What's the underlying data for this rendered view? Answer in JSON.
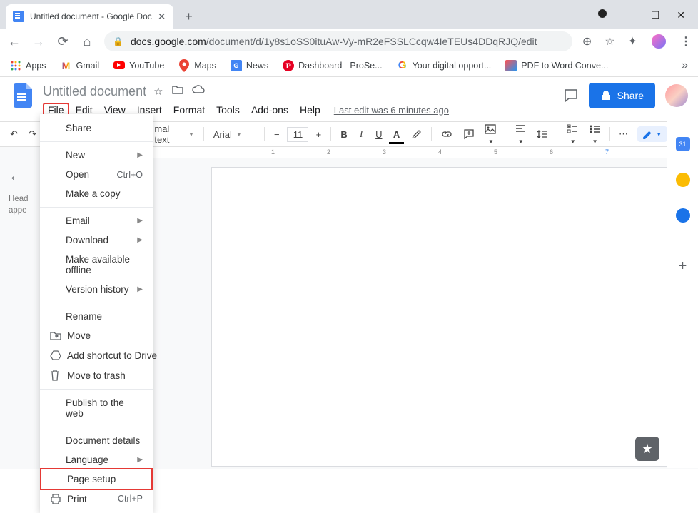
{
  "browser": {
    "tab_title": "Untitled document - Google Doc",
    "url_domain": "docs.google.com",
    "url_path": "/document/d/1y8s1oSS0ituAw-Vy-mR2eFSSLCcqw4IeTEUs4DDqRJQ/edit"
  },
  "bookmarks": {
    "apps": "Apps",
    "gmail": "Gmail",
    "youtube": "YouTube",
    "maps": "Maps",
    "news": "News",
    "dashboard": "Dashboard - ProSe...",
    "digital": "Your digital opport...",
    "pdf": "PDF to Word Conve..."
  },
  "docs": {
    "title": "Untitled document",
    "menus": {
      "file": "File",
      "edit": "Edit",
      "view": "View",
      "insert": "Insert",
      "format": "Format",
      "tools": "Tools",
      "addons": "Add-ons",
      "help": "Help"
    },
    "last_edit": "Last edit was 6 minutes ago",
    "share_label": "Share"
  },
  "toolbar": {
    "style": "mal text",
    "font": "Arial",
    "font_size": "11"
  },
  "outline": {
    "headings_text_1": "Head",
    "headings_text_2": "appe"
  },
  "file_menu": {
    "share": "Share",
    "new": "New",
    "open": "Open",
    "open_shortcut": "Ctrl+O",
    "make_copy": "Make a copy",
    "email": "Email",
    "download": "Download",
    "make_offline": "Make available offline",
    "version_history": "Version history",
    "rename": "Rename",
    "move": "Move",
    "add_shortcut": "Add shortcut to Drive",
    "move_trash": "Move to trash",
    "publish": "Publish to the web",
    "doc_details": "Document details",
    "language": "Language",
    "page_setup": "Page setup",
    "print": "Print",
    "print_shortcut": "Ctrl+P"
  },
  "ruler_numbers": [
    "1",
    "2",
    "3",
    "4",
    "5",
    "6",
    "7"
  ]
}
